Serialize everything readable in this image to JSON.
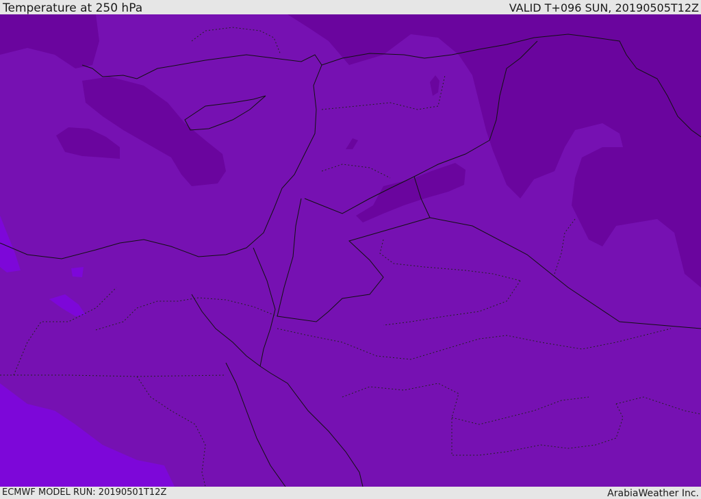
{
  "header": {
    "title": "Temperature at 250 hPa",
    "valid": "VALID T+096 SUN, 20190505T12Z"
  },
  "footer": {
    "model_run": "ECMWF MODEL RUN: 20190501T12Z",
    "credit": "ArabiaWeather Inc."
  },
  "map": {
    "field": "Temperature at 250 hPa",
    "colors": {
      "base": "#7611b2",
      "cold": "#6a059e",
      "warm": "#7d07d9",
      "border": "#111111"
    }
  }
}
